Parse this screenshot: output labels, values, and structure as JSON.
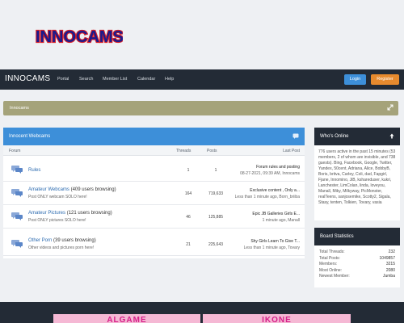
{
  "logo": {
    "text": "INNOCAMS"
  },
  "navbar": {
    "brand": "INNOCAMS",
    "links": [
      "Portal",
      "Search",
      "Member List",
      "Calendar",
      "Help"
    ],
    "login_label": "Login",
    "register_label": "Register"
  },
  "breadcrumb": {
    "text": "Innocams"
  },
  "forum": {
    "title": "Innocent Webcams",
    "columns": {
      "forum": "Forum",
      "threads": "Threads",
      "posts": "Posts",
      "last_post": "Last Post"
    },
    "rows": [
      {
        "title": "Rules",
        "browsing": "",
        "desc": "",
        "threads": "1",
        "posts": "1",
        "last_title": "Forum rules and posting",
        "last_meta": "08-27-2021, 09:39 AM, Innocams"
      },
      {
        "title": "Amateur Webcams",
        "browsing": "(409 users browsing)",
        "desc": "Post ONLY webcam SOLO here!",
        "threads": "164",
        "posts": "719,633",
        "last_title": "Exclusive content , Only a...",
        "last_meta": "Less than 1 minute ago, Born_briiba"
      },
      {
        "title": "Amateur Pictures",
        "browsing": "(121 users browsing)",
        "desc": "Post ONLY pictures SOLO here!",
        "threads": "46",
        "posts": "125,885",
        "last_title": "Epic JB Galleries Girls E...",
        "last_meta": "1 minute ago, Manall"
      },
      {
        "title": "Other Porn",
        "browsing": "(39 users browsing)",
        "desc": "Other videos and pictures porn here!",
        "threads": "21",
        "posts": "225,643",
        "last_title": "Shy Girls Learn To Give T...",
        "last_meta": "Less than 1 minute ago, Tovary"
      }
    ]
  },
  "whos_online": {
    "title": "Who's Online",
    "text": "776 users active in the past 15 minutes (53 members, 2 of whom are invisible, and 738 guests). Bing, Facebook, Google, Twitter, Yandex, 50cent, Adriana, Alice, BobbyB, Boris, britva, Carley, Coli, dad, Fapgirl, Fjane, Innomino, JiB, kshareduser, kukri, Lanchester, LimColan, linda, loveyou, Manall, Miky, Milkyway, PicMonster, realTeens, sanjosemike, Scotty2, Sigala, Stasy, tenten, Tolkien, Tovary, vasia"
  },
  "board_statistics": {
    "title": "Board Statistics",
    "rows": [
      {
        "label": "Total Threads:",
        "value": "232"
      },
      {
        "label": "Total Posts:",
        "value": "1049857"
      },
      {
        "label": "Members:",
        "value": "3215"
      },
      {
        "label": "Most Online:",
        "value": "2080"
      },
      {
        "label": "Newest Member:",
        "value": "Jumba"
      }
    ]
  },
  "footer": {
    "banners": [
      "ALGAME",
      "IKONE"
    ]
  },
  "colors": {
    "navbar": "#232b36",
    "accent_blue": "#3d8fd9",
    "register_orange": "#e68a2e",
    "breadcrumb_olive": "#a5a37a",
    "link_blue": "#2c6bb0"
  },
  "icons": [
    "brand-logo",
    "expand-icon",
    "collapse-icon",
    "forum-chat-icon",
    "chevron-up-icon"
  ]
}
